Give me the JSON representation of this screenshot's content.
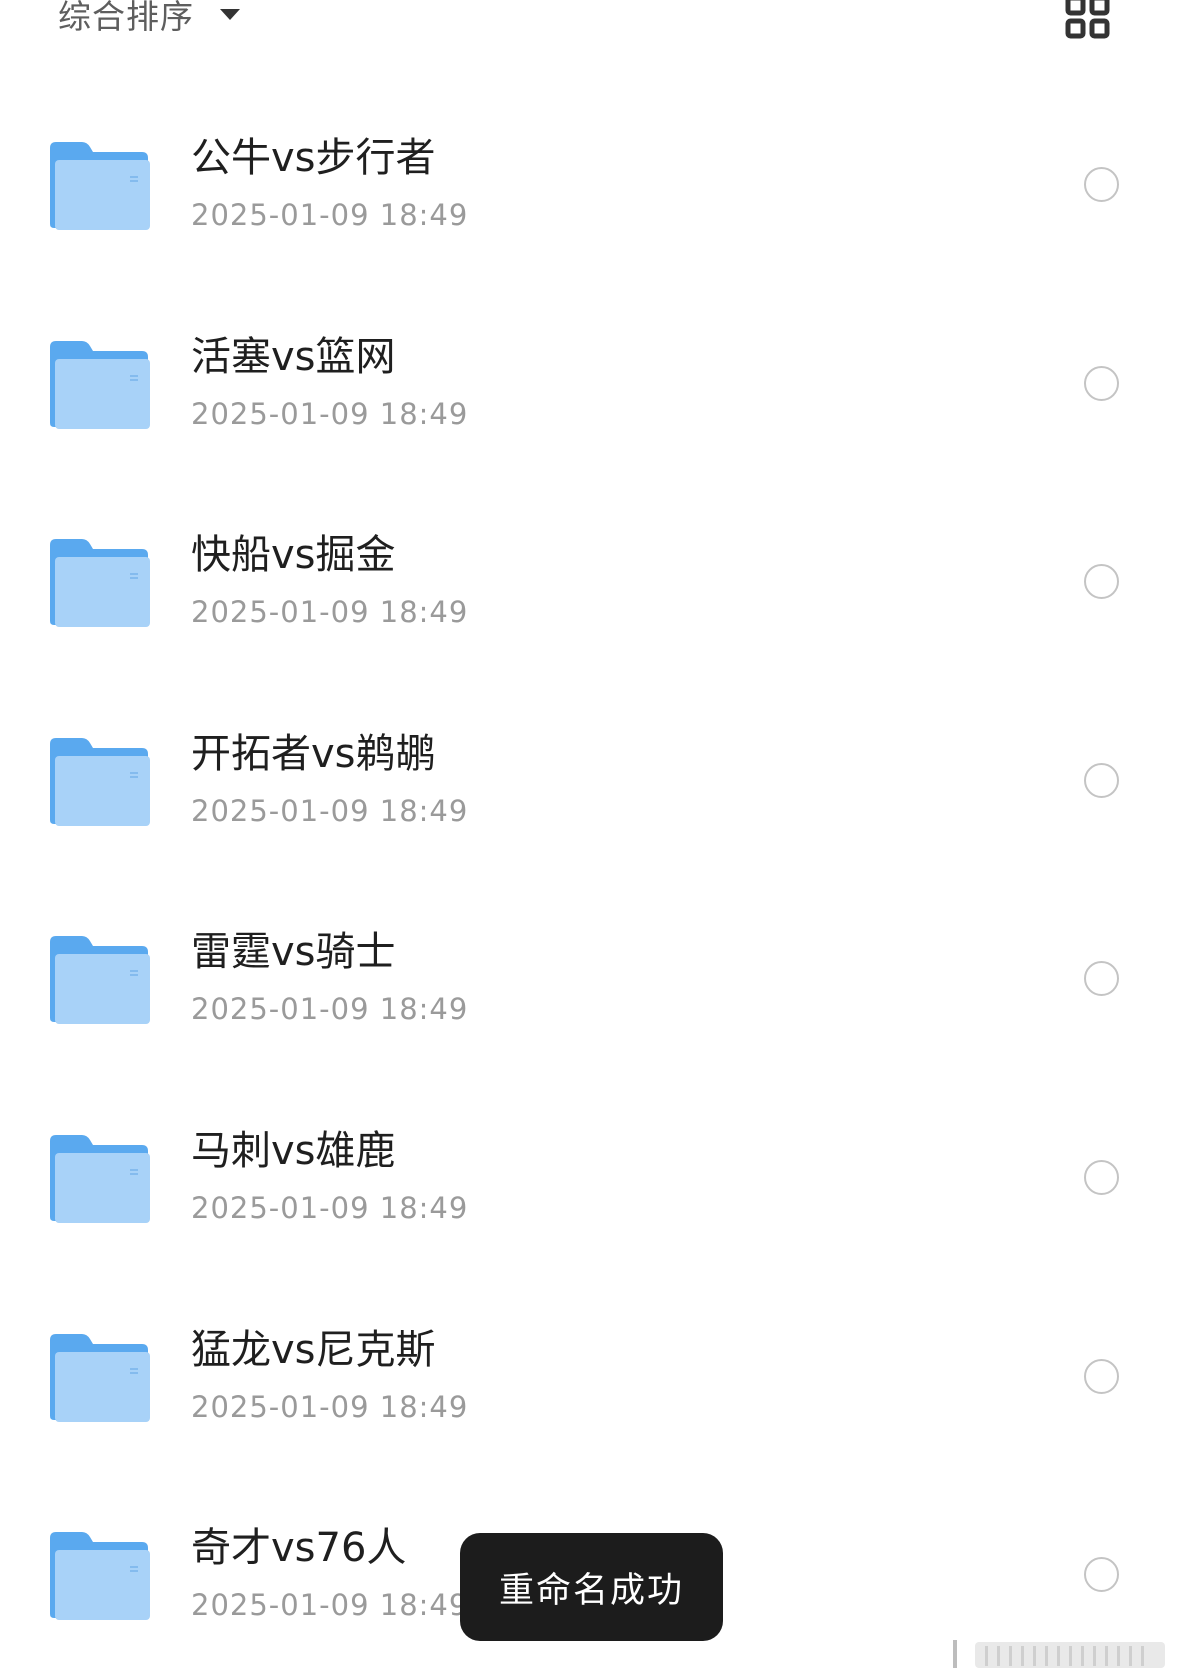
{
  "toolbar": {
    "sort_label": "综合排序",
    "sort_icon": "caret-down-icon",
    "view_icon": "grid-view-icon"
  },
  "folders": [
    {
      "name": "公牛vs步行者",
      "date": "2025-01-09 18:49"
    },
    {
      "name": "活塞vs篮网",
      "date": "2025-01-09 18:49"
    },
    {
      "name": "快船vs掘金",
      "date": "2025-01-09 18:49"
    },
    {
      "name": "开拓者vs鹈鹕",
      "date": "2025-01-09 18:49"
    },
    {
      "name": "雷霆vs骑士",
      "date": "2025-01-09 18:49"
    },
    {
      "name": "马刺vs雄鹿",
      "date": "2025-01-09 18:49"
    },
    {
      "name": "猛龙vs尼克斯",
      "date": "2025-01-09 18:49"
    },
    {
      "name": "奇才vs76人",
      "date": "2025-01-09 18:49"
    }
  ],
  "toast": {
    "message": "重命名成功"
  },
  "colors": {
    "folder_back": "#5aa9ef",
    "folder_front": "#a8d2f8",
    "toast_bg": "#1c1c1c",
    "radio_border": "#c4c4c4"
  }
}
